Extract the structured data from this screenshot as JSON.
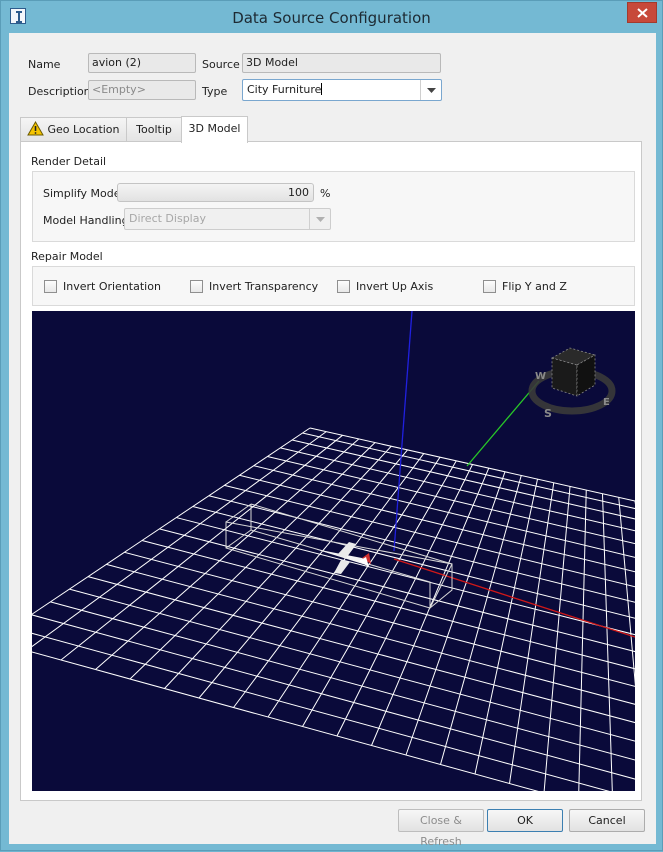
{
  "window": {
    "title": "Data Source Configuration"
  },
  "form": {
    "name_label": "Name",
    "name_value": "avion (2)",
    "source_label": "Source",
    "source_value": "3D Model",
    "description_label": "Description",
    "description_placeholder": "<Empty>",
    "type_label": "Type",
    "type_value": "City Furniture"
  },
  "tabs": [
    {
      "label": "Geo Location",
      "icon": "warning-icon"
    },
    {
      "label": "Tooltip"
    },
    {
      "label": "3D Model",
      "active": true
    }
  ],
  "render_detail": {
    "title": "Render Detail",
    "simplify_label": "Simplify Model",
    "simplify_value": "100",
    "simplify_unit": "%",
    "handling_label": "Model Handling",
    "handling_value": "Direct Display"
  },
  "repair_model": {
    "title": "Repair Model",
    "options": [
      {
        "label": "Invert Orientation",
        "checked": false
      },
      {
        "label": "Invert Transparency",
        "checked": false
      },
      {
        "label": "Invert Up Axis",
        "checked": false
      },
      {
        "label": "Flip Y and Z",
        "checked": false
      }
    ]
  },
  "viewer": {
    "compass_labels": [
      "W",
      "S",
      "E"
    ],
    "background": "#0a0a3a",
    "axis_colors": {
      "x": "#d01818",
      "y": "#28c828",
      "z": "#2020e0"
    }
  },
  "buttons": {
    "close_refresh": "Close & Refresh",
    "ok": "OK",
    "cancel": "Cancel"
  },
  "colors": {
    "frame": "#74b9d3",
    "close_button": "#c7493a",
    "warning": "#f5c400"
  }
}
